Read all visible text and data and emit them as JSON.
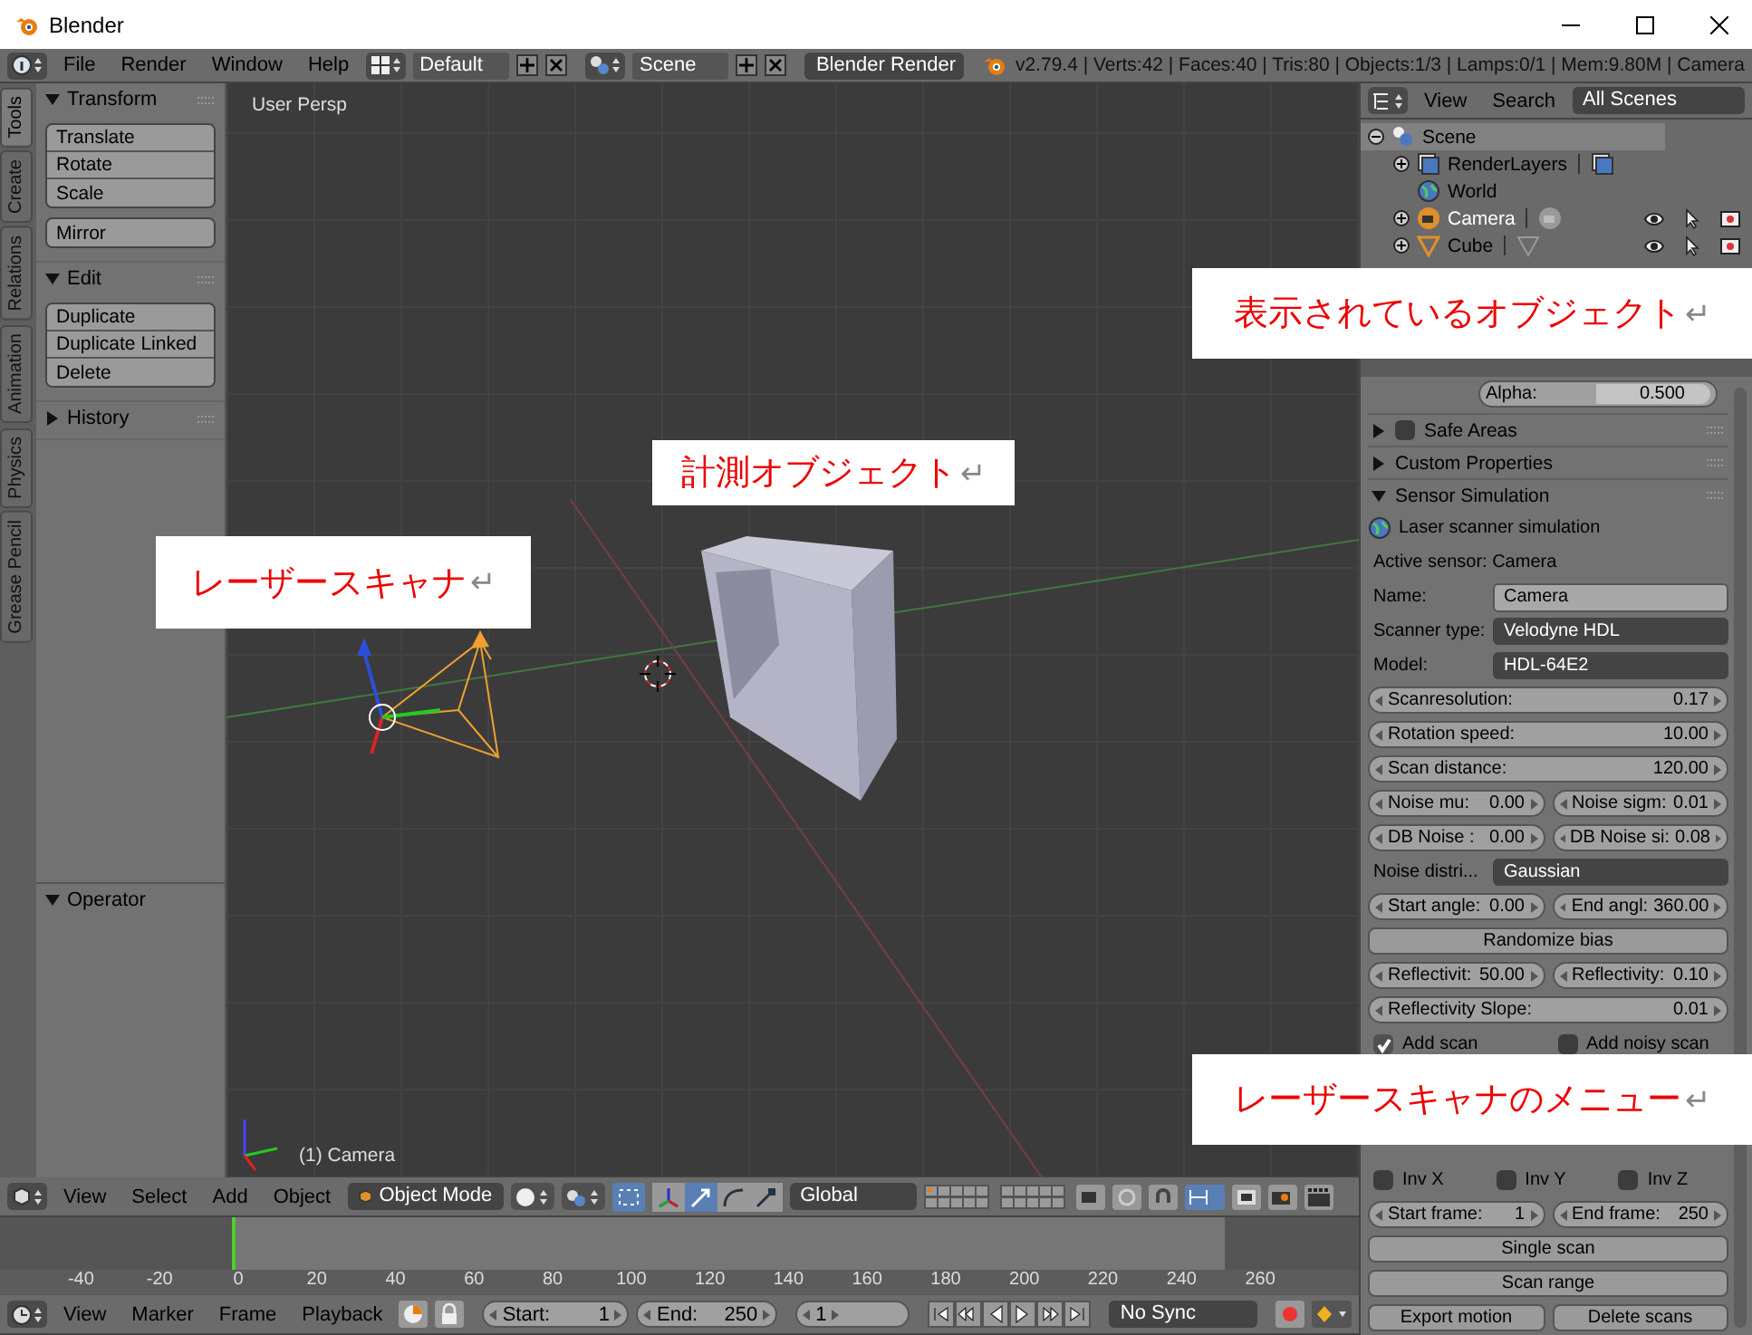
{
  "window": {
    "title": "Blender"
  },
  "info_header": {
    "menus": [
      "File",
      "Render",
      "Window",
      "Help"
    ],
    "layout": "Default",
    "scene": "Scene",
    "engine": "Blender Render",
    "stats": "v2.79.4 | Verts:42 | Faces:40 | Tris:80 | Objects:1/3 | Lamps:0/1 | Mem:9.80M | Camera"
  },
  "tool_tabs": [
    {
      "label": "Tools",
      "selected": true
    },
    {
      "label": "Create",
      "selected": false
    },
    {
      "label": "Relations",
      "selected": false
    },
    {
      "label": "Animation",
      "selected": false
    },
    {
      "label": "Physics",
      "selected": false
    },
    {
      "label": "Grease Pencil",
      "selected": false
    }
  ],
  "tool_shelf": {
    "panels": [
      {
        "title": "Transform",
        "expanded": true,
        "groups": [
          [
            "Translate",
            "Rotate",
            "Scale"
          ],
          [
            "Mirror"
          ]
        ]
      },
      {
        "title": "Edit",
        "expanded": true,
        "groups": [
          [
            "Duplicate",
            "Duplicate Linked",
            "Delete"
          ]
        ]
      },
      {
        "title": "History",
        "expanded": false
      }
    ],
    "operator": {
      "title": "Operator",
      "expanded": true
    }
  },
  "viewport": {
    "view_label": "User Persp",
    "object_label": "(1) Camera"
  },
  "view_header": {
    "menus": [
      "View",
      "Select",
      "Add",
      "Object"
    ],
    "mode": "Object Mode",
    "orientation": "Global"
  },
  "timeline": {
    "ruler": [
      "-40",
      "-20",
      "0",
      "20",
      "40",
      "60",
      "80",
      "100",
      "120",
      "140",
      "160",
      "180",
      "200",
      "220",
      "240",
      "260"
    ]
  },
  "timeline_header": {
    "menus": [
      "View",
      "Marker",
      "Frame",
      "Playback"
    ],
    "start_label": "Start:",
    "start": "1",
    "end_label": "End:",
    "end": "250",
    "current": "1",
    "sync": "No Sync"
  },
  "outliner": {
    "menus": [
      "View",
      "Search"
    ],
    "filter": "All Scenes",
    "tree": [
      {
        "label": "Scene",
        "kind": "scene",
        "expanded": true,
        "selected": true,
        "children": [
          {
            "label": "RenderLayers",
            "kind": "layers",
            "expanded": false,
            "selected": false
          },
          {
            "label": "World",
            "kind": "world",
            "selected": false
          },
          {
            "label": "Camera",
            "kind": "camera",
            "expanded": false,
            "selected": true
          },
          {
            "label": "Cube",
            "kind": "mesh",
            "expanded": false,
            "selected": false
          }
        ]
      }
    ]
  },
  "properties": {
    "alpha_label": "Alpha:",
    "alpha_value": "0.500",
    "panels": [
      {
        "title": "Safe Areas",
        "kind": "check_panel",
        "checked": false,
        "expanded": false
      },
      {
        "title": "Custom Properties",
        "kind": "panel",
        "expanded": false
      },
      {
        "title": "Sensor Simulation",
        "kind": "panel",
        "expanded": true
      }
    ],
    "rows": [
      {
        "kind": "heading",
        "text": "Laser scanner simulation"
      },
      {
        "kind": "text",
        "text": "Active sensor: Camera"
      },
      {
        "kind": "field",
        "label": "Name:",
        "value": "Camera"
      },
      {
        "kind": "dropdown",
        "label": "Scanner type:",
        "value": "Velodyne HDL"
      },
      {
        "kind": "dropdown",
        "label": "Model:",
        "value": "HDL-64E2"
      },
      {
        "kind": "numbers",
        "items": [
          {
            "label": "Scanresolution:",
            "value": "0.17"
          }
        ]
      },
      {
        "kind": "numbers",
        "items": [
          {
            "label": "Rotation speed:",
            "value": "10.00"
          }
        ]
      },
      {
        "kind": "numbers",
        "items": [
          {
            "label": "Scan distance:",
            "value": "120.00"
          }
        ]
      },
      {
        "kind": "numbers",
        "items": [
          {
            "label": "Noise mu:",
            "value": "0.00"
          },
          {
            "label": "Noise sigm:",
            "value": "0.01"
          }
        ]
      },
      {
        "kind": "numbers",
        "items": [
          {
            "label": "DB Noise :",
            "value": "0.00"
          },
          {
            "label": "DB Noise si:",
            "value": "0.08"
          }
        ]
      },
      {
        "kind": "dropdown",
        "label": "Noise distri...",
        "value": "Gaussian"
      },
      {
        "kind": "numbers",
        "items": [
          {
            "label": "Start angle:",
            "value": "0.00"
          },
          {
            "label": "End angl:",
            "value": "360.00"
          }
        ]
      },
      {
        "kind": "buttons",
        "items": [
          "Randomize bias"
        ]
      },
      {
        "kind": "numbers",
        "items": [
          {
            "label": "Reflectivit:",
            "value": "50.00"
          },
          {
            "label": "Reflectivity:",
            "value": "0.10"
          }
        ]
      },
      {
        "kind": "numbers",
        "items": [
          {
            "label": "Reflectivity Slope:",
            "value": "0.01"
          }
        ]
      },
      {
        "kind": "checks",
        "items": [
          {
            "label": "Add scan",
            "checked": true
          },
          {
            "label": "Add noisy scan",
            "checked": false
          }
        ]
      }
    ],
    "rows_below": [
      {
        "kind": "checks",
        "items": [
          {
            "label": "Inv X",
            "checked": false
          },
          {
            "label": "Inv Y",
            "checked": false
          },
          {
            "label": "Inv Z",
            "checked": false
          }
        ]
      },
      {
        "kind": "numbers",
        "items": [
          {
            "label": "Start frame:",
            "value": "1"
          },
          {
            "label": "End frame:",
            "value": "250"
          }
        ]
      },
      {
        "kind": "buttons",
        "items": [
          "Single scan"
        ]
      },
      {
        "kind": "buttons",
        "items": [
          "Scan range"
        ]
      },
      {
        "kind": "buttons",
        "items": [
          "Export motion",
          "Delete scans"
        ]
      }
    ]
  },
  "annotations": [
    {
      "text": "表示されているオブジェクト",
      "mark": "↵"
    },
    {
      "text": "計測オブジェクト",
      "mark": "↵"
    },
    {
      "text": "レーザースキャナ",
      "mark": "↵"
    },
    {
      "text": "レーザースキャナのメニュー",
      "mark": "↵"
    }
  ]
}
